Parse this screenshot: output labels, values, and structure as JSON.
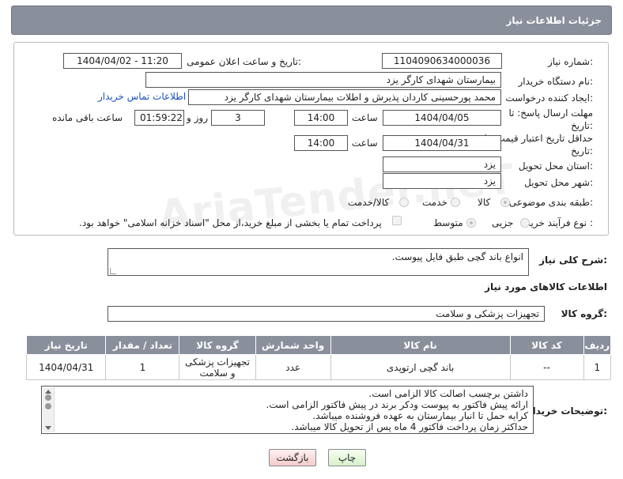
{
  "header": {
    "title": "جزئیات اطلاعات نیاز"
  },
  "form": {
    "need_number_label": "شماره نیاز:",
    "need_number": "1104090634000036",
    "announce_label": "تاریخ و ساعت اعلان عمومی:",
    "announce_value": "1404/04/02 - 11:20",
    "buyer_org_label": "نام دستگاه خریدار:",
    "buyer_org": "بیمارستان شهدای کارگر یزد",
    "creator_label": "ایجاد کننده درخواست:",
    "creator": "محمد پورحسینی کاردان پذیرش و اطلات بیمارستان شهدای کارگر یزد",
    "contact_link": "اطلاعات تماس خریدار",
    "deadline_label": "مهلت ارسال پاسخ: تا تاریخ:",
    "deadline_date": "1404/04/05",
    "hour_label": "ساعت",
    "deadline_time": "14:00",
    "days_value": "3",
    "days_label": "روز و",
    "remaining_time": "01:59:22",
    "remaining_label": "ساعت باقی مانده",
    "min_validity_label": "حداقل تاریخ اعتبار قیمت: تا تاریخ:",
    "validity_date": "1404/04/31",
    "validity_time": "14:00",
    "province_label": "استان محل تحویل:",
    "province": "یزد",
    "city_label": "شهر محل تحویل:",
    "city": "یزد",
    "category_label": "طبقه بندی موضوعی:",
    "category_options": [
      "کالا",
      "خدمت",
      "کالا/خدمت"
    ],
    "process_label": "نوع فرآیند خرید :",
    "process_options": [
      "جزیی",
      "متوسط"
    ],
    "payment_note": "پرداخت تمام یا بخشی از مبلغ خرید،از محل \"اسناد خزانه اسلامی\" خواهد بود."
  },
  "description": {
    "label": "شرح کلی نیاز:",
    "text": "انواع باند گچی طبق فایل پیوست."
  },
  "goods": {
    "section_title": "اطلاعات کالاهای مورد نیاز",
    "group_label": "گروه کالا:",
    "group_value": "تجهیزات پزشکی و سلامت",
    "columns": [
      "ردیف",
      "کد کالا",
      "نام کالا",
      "واحد شمارش",
      "گروه کالا",
      "تعداد / مقدار",
      "تاریخ نیاز"
    ],
    "rows": [
      [
        "1",
        "--",
        "باند گچی ارتوپدی",
        "عدد",
        "تجهیزات پزشکی و سلامت",
        "1",
        "1404/04/31"
      ]
    ]
  },
  "buyer_notes": {
    "label": "توضیحات خریدار:",
    "lines": [
      "داشتن برچسب اصالت کالا الزامی است.",
      "ارائه پیش فاکتور به پیوست ودکر برند در پیش فاکتور الزامی است.",
      "کرایه حمل تا انبار بیمارستان به عهده فروشنده میباشد.",
      "حداکثر زمان پرداخت فاکتور 4 ماه پس از تحویل کالا میباشد."
    ]
  },
  "buttons": {
    "print": "چاپ",
    "back": "بازگشت"
  },
  "watermark": "AriaTender.neT"
}
